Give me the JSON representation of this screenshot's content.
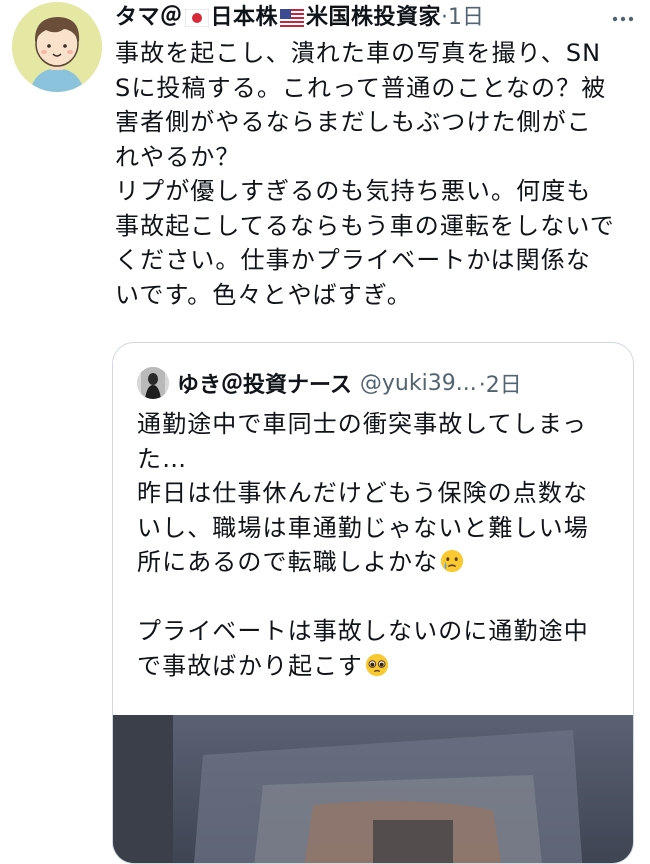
{
  "tweet": {
    "display_name_prefix": "タマ＠",
    "display_name_mid": "日本株",
    "display_name_suffix": "米国株投資家",
    "time": "·1日",
    "text": "事故を起こし、潰れた車の写真を撮り、SNSに投稿する。これって普通のことなの？被害者側がやるならまだしもぶつけた側がこれやるか？\nリプが優しすぎるのも気持ち悪い。何度も事故起こしてるならもう車の運転をしないでください。仕事かプライベートかは関係ないです。色々とやばすぎ。"
  },
  "quote": {
    "name": "ゆき＠投資ナース",
    "handle": "@yuki39...",
    "time": "·2日",
    "text_part1": "通勤途中で車同士の衝突事故してしまった…\n昨日は仕事休んだけどもう保険の点数ないし、職場は車通勤じゃないと難しい場所にあるので転職しよかな",
    "text_part2": "\n\nプライベートは事故しないのに通勤途中で事故ばかり起こす"
  },
  "icons": {
    "more": "more-horizontal-icon",
    "flag_jp": "japan-flag-icon",
    "flag_us": "us-flag-icon",
    "emoji_tear": "face-holding-back-tears-icon",
    "emoji_pleading": "pleading-face-icon"
  },
  "colors": {
    "text": "#0f1419",
    "secondary": "#536471",
    "border": "#cfd9de",
    "avatar_bg": "#e4e8a3"
  }
}
